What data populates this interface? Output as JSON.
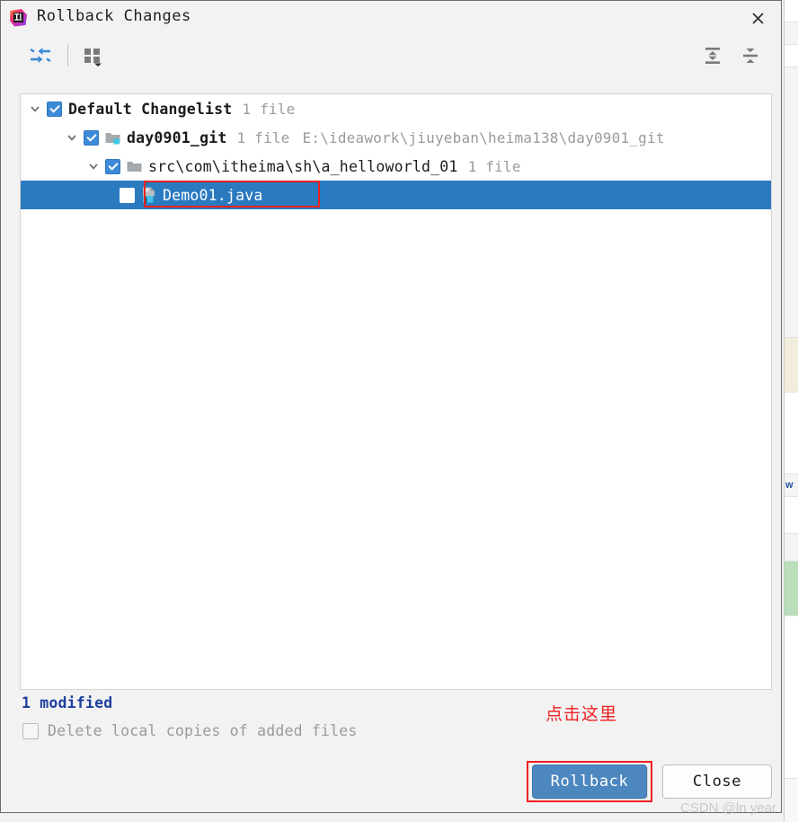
{
  "window": {
    "title": "Rollback Changes",
    "app_icon": "intellij-idea-icon",
    "close_label": "✕"
  },
  "toolbar": {
    "items": [
      {
        "name": "revert-selected-icon",
        "tooltip": "Revert Selected"
      },
      {
        "name": "group-by-icon",
        "tooltip": "Group By"
      },
      {
        "name": "expand-all-icon",
        "tooltip": "Expand All"
      },
      {
        "name": "collapse-all-icon",
        "tooltip": "Collapse All"
      }
    ]
  },
  "tree": {
    "rows": [
      {
        "level": 0,
        "twisty": "expanded",
        "checked": true,
        "icon": null,
        "label": "Default Changelist",
        "bold": true,
        "meta": "1 file",
        "path": "",
        "selected": false
      },
      {
        "level": 1,
        "twisty": "expanded",
        "checked": true,
        "icon": "folder-module-icon",
        "label": "day0901_git",
        "bold": true,
        "meta": "1 file",
        "path": "E:\\ideawork\\jiuyeban\\heima138\\day0901_git",
        "selected": false
      },
      {
        "level": 2,
        "twisty": "expanded",
        "checked": true,
        "icon": "folder-icon",
        "label": "src\\com\\itheima\\sh\\a_helloworld_01",
        "bold": false,
        "meta": "1 file",
        "path": "",
        "selected": false
      },
      {
        "level": 3,
        "twisty": "none",
        "checked": true,
        "icon": "java-file-icon",
        "label": "Demo01.java",
        "bold": false,
        "meta": "",
        "path": "",
        "selected": true
      }
    ]
  },
  "footer": {
    "modified_text": "1 modified",
    "delete_local_label": "Delete local copies of added files",
    "delete_local_checked": false,
    "rollback_label": "Rollback",
    "close_label": "Close"
  },
  "annotations": {
    "click_here_text": "点击这里",
    "annotation_color": "#ef2020"
  },
  "watermark": {
    "text": "CSDN @ln year"
  },
  "background_window": {
    "link_text": "w"
  },
  "colors": {
    "selection_blue": "#2a7ac0",
    "primary_button": "#4c87bf",
    "checkbox_blue": "#3d8ad8",
    "modified_text": "#1f3fa0",
    "meta_gray": "#9a9a9a",
    "dialog_bg": "#f2f2f2"
  }
}
